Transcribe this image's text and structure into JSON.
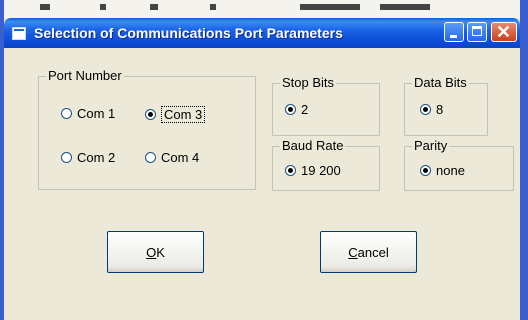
{
  "window": {
    "title": "Selection of Communications Port Parameters"
  },
  "port_number": {
    "label": "Port Number",
    "options": [
      {
        "label": "Com 1",
        "checked": false
      },
      {
        "label": "Com 3",
        "checked": true
      },
      {
        "label": "Com 2",
        "checked": false
      },
      {
        "label": "Com 4",
        "checked": false
      }
    ]
  },
  "stop_bits": {
    "label": "Stop Bits",
    "value": "2"
  },
  "data_bits": {
    "label": "Data Bits",
    "value": "8"
  },
  "baud_rate": {
    "label": "Baud Rate",
    "value": "19 200"
  },
  "parity": {
    "label": "Parity",
    "value": "none"
  },
  "buttons": {
    "ok_first": "O",
    "ok_rest": "K",
    "cancel_first": "C",
    "cancel_rest": "ancel"
  },
  "colors": {
    "titlebar": "#0b4bd6",
    "dialog_bg": "#ece9d8",
    "button_border": "#003c74"
  }
}
